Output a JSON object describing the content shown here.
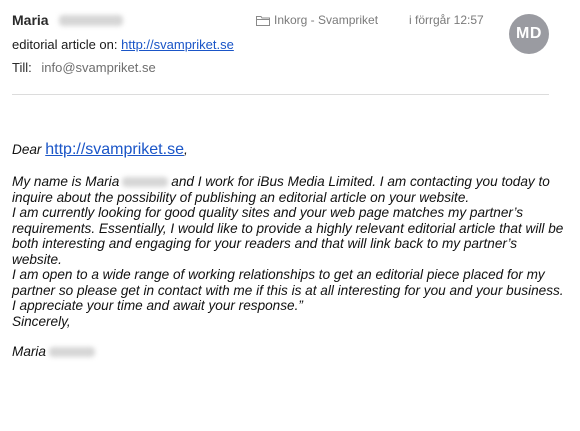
{
  "header": {
    "sender_name": "Maria",
    "mailbox": "Inkorg - Svampriket",
    "date": "i förrgår 12:57",
    "avatar_initials": "MD",
    "subject_prefix": "editorial article on:",
    "subject_link": "http://svampriket.se",
    "to_label": "Till:",
    "to_value": "info@svampriket.se"
  },
  "body": {
    "greeting_prefix": "Dear",
    "greeting_link": "http://svampriket.se",
    "greeting_suffix": ",",
    "intro_before": "My name is Maria",
    "intro_after": "and I work for iBus Media Limited. I am contacting you today to inquire about the possibility of publishing an editorial article on your website.",
    "para2": "I am currently looking for good quality sites and your web page matches my partner’s requirements. Essentially, I would like to provide a highly relevant editorial article that will be both interesting and engaging for your readers and that will link back to my partner’s website.",
    "para3": "I am open to a wide range of working relationships to get an editorial piece placed for my partner so please get in contact with me if this is at all interesting for you and your business.",
    "para4": "I appreciate your time and await your response.”",
    "closing": "Sincerely,",
    "signature": "Maria"
  },
  "colors": {
    "link": "#1a55c7",
    "avatar_bg": "#9a9ba1",
    "meta_text": "#7a7a7a"
  }
}
